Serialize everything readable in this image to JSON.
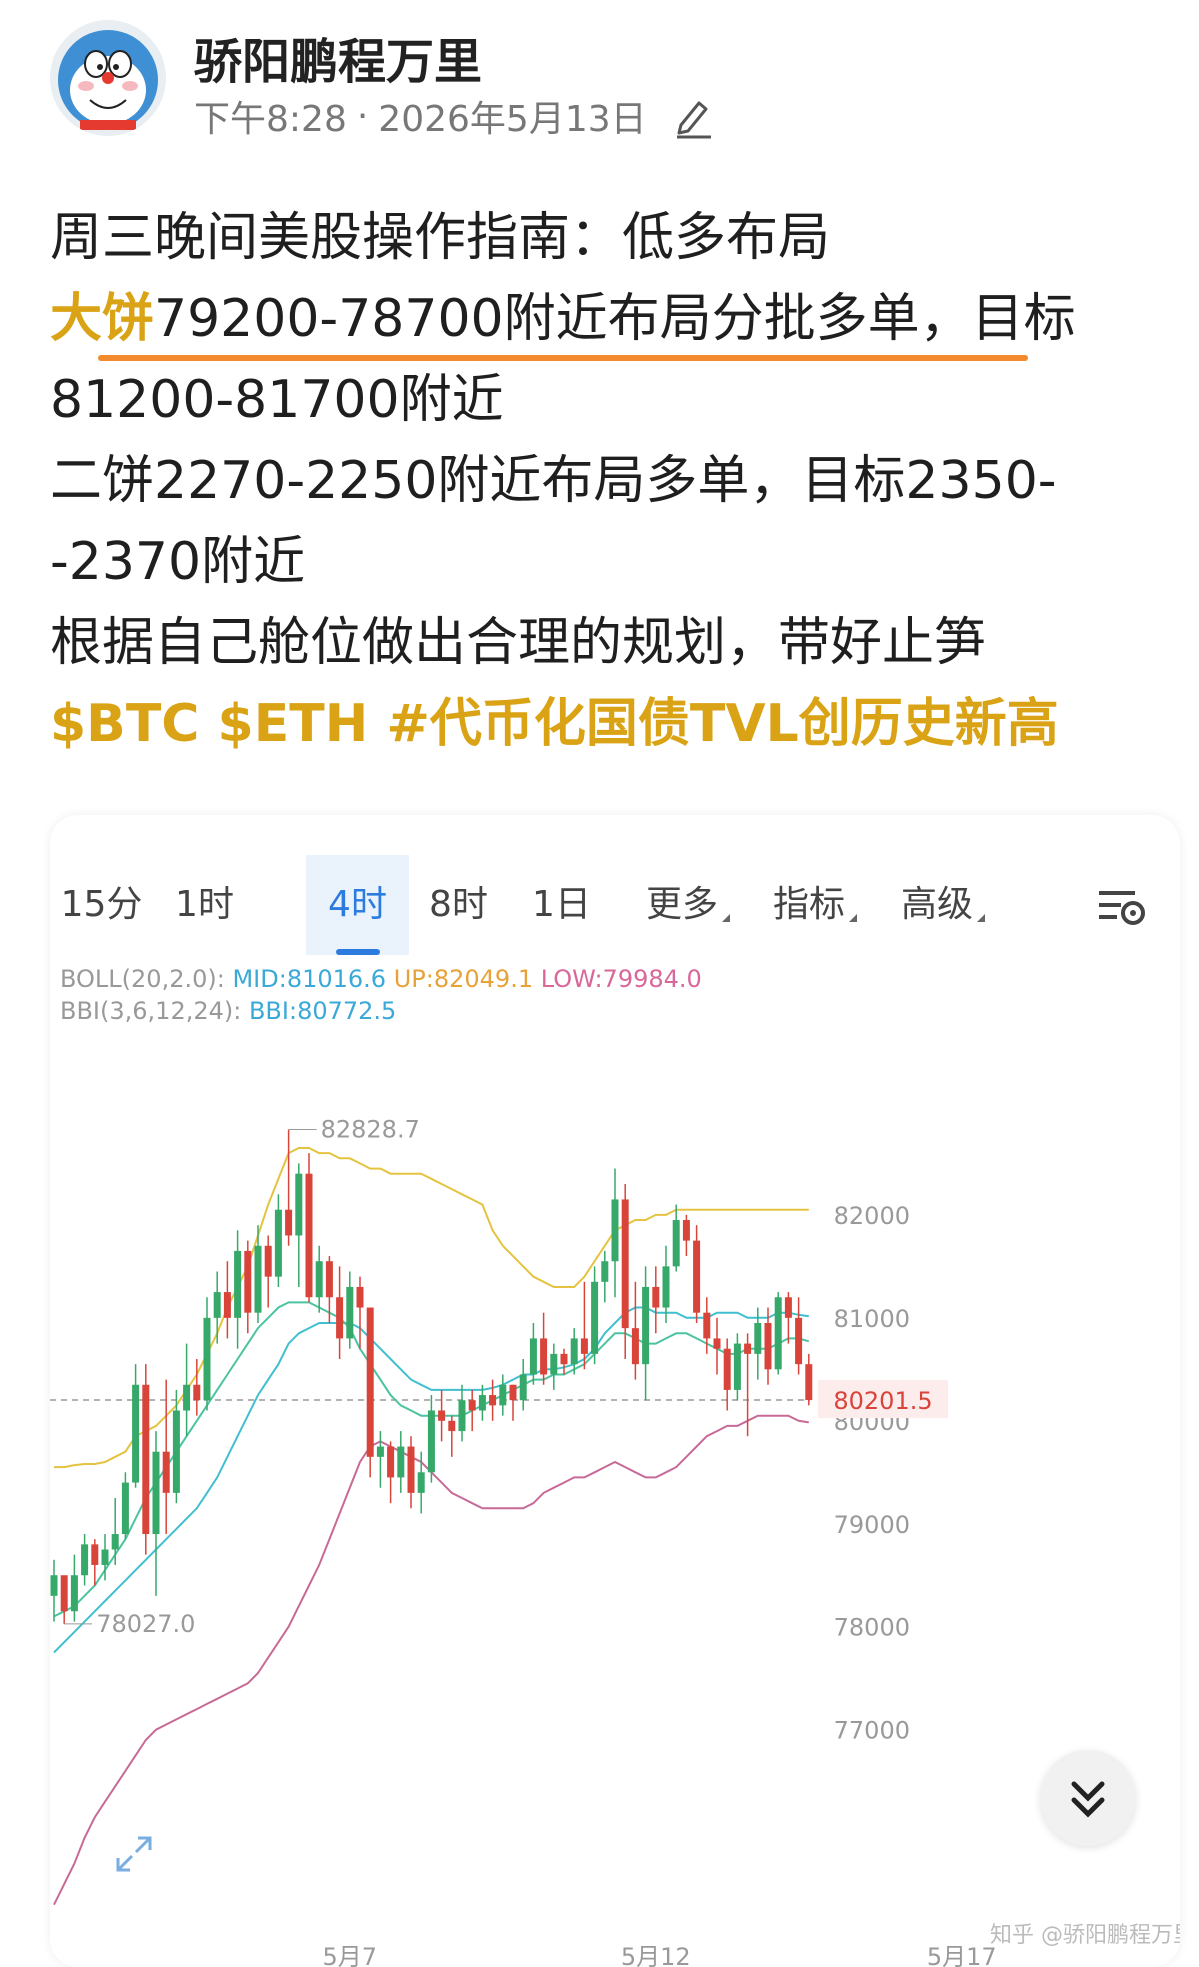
{
  "header": {
    "author": "骄阳鹏程万里",
    "time": "下午8:28",
    "separator": "·",
    "date": "2026年5月13日"
  },
  "post": {
    "line1": "周三晚间美股操作指南：低多布局",
    "line2_highlight": "大饼",
    "line2_rest": "79200-78700附近布局分批多单，目标",
    "line3": "81200-81700附近",
    "line4": "二饼2270-2250附近布局多单，目标2350-",
    "line5": "-2370附近",
    "line6": "根据自己舱位做出合理的规划，带好止笋",
    "tags": "$BTC $ETH #代币化国债TVL创历史新高"
  },
  "chart_card": {
    "tabs": [
      {
        "label": "15分",
        "active": false
      },
      {
        "label": "1时",
        "active": false
      },
      {
        "label": "4时",
        "active": true
      },
      {
        "label": "8时",
        "active": false
      },
      {
        "label": "1日",
        "active": false
      },
      {
        "label": "更多",
        "active": false
      },
      {
        "label": "指标",
        "active": false
      },
      {
        "label": "高级",
        "active": false
      }
    ],
    "boll_prefix": "BOLL(20,2.0):",
    "boll_mid": "MID:81016.6",
    "boll_up": "UP:82049.1",
    "boll_low": "LOW:79984.0",
    "bbi_prefix": "BBI(3,6,12,24):",
    "bbi_value": "BBI:80772.5",
    "watermark": "知乎 @骄阳鹏程万里"
  },
  "chart_data": {
    "type": "candlestick",
    "y_ticks": [
      82000,
      81000,
      80000,
      79000,
      78000,
      77000
    ],
    "ylim": [
      75200,
      83650
    ],
    "x_labels": [
      {
        "label": "5月7",
        "index": 29
      },
      {
        "label": "5月12",
        "index": 59
      },
      {
        "label": "5月17",
        "index": 89
      }
    ],
    "current_price": 80201.5,
    "high_label": 82828.7,
    "low_label": 78027.0,
    "candles_ohlc": [
      [
        78300,
        78650,
        78050,
        78500
      ],
      [
        78500,
        78400,
        78027,
        78150
      ],
      [
        78150,
        78700,
        78050,
        78500
      ],
      [
        78500,
        78900,
        78400,
        78800
      ],
      [
        78800,
        78850,
        78400,
        78600
      ],
      [
        78600,
        78900,
        78450,
        78750
      ],
      [
        78750,
        79250,
        78600,
        78900
      ],
      [
        78900,
        79500,
        78850,
        79400
      ],
      [
        79400,
        80550,
        79350,
        80350
      ],
      [
        80350,
        80550,
        78700,
        78900
      ],
      [
        78900,
        79900,
        78300,
        79700
      ],
      [
        79700,
        80400,
        78900,
        79300
      ],
      [
        79300,
        80300,
        79200,
        80100
      ],
      [
        80100,
        80750,
        79850,
        80350
      ],
      [
        80350,
        80600,
        80050,
        80200
      ],
      [
        80200,
        81200,
        80100,
        81000
      ],
      [
        81000,
        81450,
        80750,
        81250
      ],
      [
        81250,
        81550,
        80800,
        81000
      ],
      [
        81000,
        81850,
        80700,
        81650
      ],
      [
        81650,
        81750,
        80850,
        81050
      ],
      [
        81050,
        81900,
        80950,
        81700
      ],
      [
        81700,
        81800,
        81100,
        81400
      ],
      [
        81400,
        82200,
        81300,
        82050
      ],
      [
        82050,
        82828.7,
        81700,
        81800
      ],
      [
        81800,
        82500,
        81300,
        82400
      ],
      [
        82400,
        82600,
        81150,
        81200
      ],
      [
        81200,
        81700,
        81050,
        81550
      ],
      [
        81550,
        81600,
        80950,
        81200
      ],
      [
        81200,
        81500,
        80600,
        80800
      ],
      [
        80800,
        81450,
        80700,
        81300
      ],
      [
        81300,
        81400,
        80700,
        81100
      ],
      [
        81100,
        81100,
        79450,
        79650
      ],
      [
        79650,
        79900,
        79350,
        79750
      ],
      [
        79750,
        79800,
        79200,
        79450
      ],
      [
        79450,
        79900,
        79300,
        79750
      ],
      [
        79750,
        79850,
        79150,
        79300
      ],
      [
        79300,
        79700,
        79100,
        79500
      ],
      [
        79500,
        80250,
        79400,
        80100
      ],
      [
        80100,
        80300,
        79800,
        80000
      ],
      [
        80000,
        80050,
        79650,
        79900
      ],
      [
        79900,
        80350,
        79800,
        80200
      ],
      [
        80200,
        80300,
        79900,
        80100
      ],
      [
        80100,
        80350,
        80000,
        80250
      ],
      [
        80250,
        80400,
        80000,
        80150
      ],
      [
        80150,
        80450,
        80050,
        80350
      ],
      [
        80350,
        80350,
        80000,
        80200
      ],
      [
        80200,
        80600,
        80100,
        80450
      ],
      [
        80450,
        80950,
        80350,
        80800
      ],
      [
        80800,
        81050,
        80350,
        80450
      ],
      [
        80450,
        80750,
        80300,
        80650
      ],
      [
        80650,
        80700,
        80450,
        80550
      ],
      [
        80550,
        80900,
        80450,
        80800
      ],
      [
        80800,
        81350,
        80500,
        80650
      ],
      [
        80650,
        81500,
        80550,
        81350
      ],
      [
        81350,
        81650,
        81150,
        81550
      ],
      [
        81550,
        82450,
        81200,
        82150
      ],
      [
        82150,
        82300,
        80600,
        80900
      ],
      [
        80900,
        81350,
        80400,
        80550
      ],
      [
        80550,
        81500,
        80200,
        81300
      ],
      [
        81300,
        81500,
        80850,
        81100
      ],
      [
        81100,
        81700,
        80950,
        81500
      ],
      [
        81500,
        82100,
        81450,
        81950
      ],
      [
        81950,
        82000,
        81600,
        81750
      ],
      [
        81750,
        81900,
        80950,
        81050
      ],
      [
        81050,
        81200,
        80650,
        80800
      ],
      [
        80800,
        81000,
        80450,
        80700
      ],
      [
        80700,
        80800,
        80100,
        80300
      ],
      [
        80300,
        80850,
        80200,
        80750
      ],
      [
        80750,
        80850,
        79850,
        80650
      ],
      [
        80650,
        81100,
        80400,
        80950
      ],
      [
        80950,
        81100,
        80350,
        80500
      ],
      [
        80500,
        81250,
        80450,
        81200
      ],
      [
        81200,
        81250,
        80750,
        81000
      ],
      [
        81000,
        81200,
        80450,
        80550
      ],
      [
        80550,
        80650,
        80150,
        80201.5
      ]
    ],
    "series": [
      {
        "key": "up",
        "color": "#e5c340",
        "values": [
          79550,
          79550,
          79570,
          79580,
          79580,
          79600,
          79650,
          79700,
          79850,
          79900,
          79950,
          80050,
          80150,
          80300,
          80450,
          80650,
          80850,
          81100,
          81300,
          81500,
          81800,
          82100,
          82350,
          82600,
          82650,
          82650,
          82600,
          82600,
          82550,
          82550,
          82500,
          82450,
          82450,
          82400,
          82400,
          82400,
          82400,
          82350,
          82300,
          82250,
          82200,
          82150,
          82100,
          81850,
          81700,
          81600,
          81500,
          81400,
          81350,
          81300,
          81300,
          81300,
          81400,
          81550,
          81700,
          81850,
          81900,
          81950,
          81950,
          82000,
          82000,
          82050,
          82050,
          82050,
          82050,
          82050,
          82050,
          82050,
          82050,
          82050,
          82050,
          82050,
          82050,
          82049,
          82049
        ]
      },
      {
        "key": "mid",
        "color": "#3fbfd0",
        "values": [
          77750,
          77850,
          77950,
          78050,
          78150,
          78250,
          78350,
          78450,
          78550,
          78650,
          78750,
          78850,
          78950,
          79050,
          79150,
          79300,
          79450,
          79650,
          79850,
          80050,
          80250,
          80400,
          80550,
          80750,
          80850,
          80900,
          80950,
          80950,
          80950,
          80950,
          80900,
          80800,
          80700,
          80600,
          80500,
          80400,
          80350,
          80300,
          80300,
          80300,
          80300,
          80300,
          80300,
          80320,
          80350,
          80400,
          80450,
          80450,
          80500,
          80500,
          80520,
          80550,
          80600,
          80700,
          80850,
          80950,
          81050,
          81100,
          81100,
          81050,
          81050,
          81050,
          81000,
          81000,
          81000,
          81050,
          81050,
          81050,
          81000,
          81000,
          81000,
          81050,
          81050,
          81030,
          81016
        ]
      },
      {
        "key": "low",
        "color": "#c86a96",
        "values": [
          75300,
          75500,
          75700,
          75950,
          76150,
          76300,
          76450,
          76600,
          76750,
          76900,
          77000,
          77050,
          77100,
          77150,
          77200,
          77250,
          77300,
          77350,
          77400,
          77450,
          77550,
          77700,
          77850,
          78000,
          78200,
          78400,
          78600,
          78850,
          79100,
          79350,
          79600,
          79750,
          79800,
          79750,
          79700,
          79650,
          79600,
          79500,
          79400,
          79300,
          79250,
          79200,
          79150,
          79150,
          79150,
          79150,
          79150,
          79200,
          79300,
          79350,
          79400,
          79450,
          79450,
          79500,
          79550,
          79600,
          79550,
          79500,
          79450,
          79450,
          79500,
          79550,
          79650,
          79750,
          79850,
          79900,
          79950,
          79950,
          80000,
          80050,
          80050,
          80050,
          80050,
          80000,
          79984
        ]
      },
      {
        "key": "bbi",
        "color": "#4cc3a0",
        "values": [
          78100,
          78150,
          78200,
          78300,
          78400,
          78550,
          78700,
          78850,
          79050,
          79250,
          79400,
          79550,
          79700,
          79850,
          80000,
          80150,
          80300,
          80450,
          80600,
          80750,
          80900,
          81000,
          81100,
          81150,
          81150,
          81150,
          81100,
          81050,
          81000,
          80900,
          80700,
          80550,
          80400,
          80250,
          80150,
          80100,
          80050,
          80050,
          80050,
          80050,
          80050,
          80100,
          80150,
          80200,
          80250,
          80300,
          80350,
          80400,
          80400,
          80450,
          80450,
          80500,
          80550,
          80650,
          80750,
          80850,
          80850,
          80800,
          80750,
          80750,
          80800,
          80850,
          80850,
          80800,
          80750,
          80700,
          80650,
          80650,
          80700,
          80700,
          80700,
          80750,
          80800,
          80800,
          80772
        ]
      }
    ]
  }
}
